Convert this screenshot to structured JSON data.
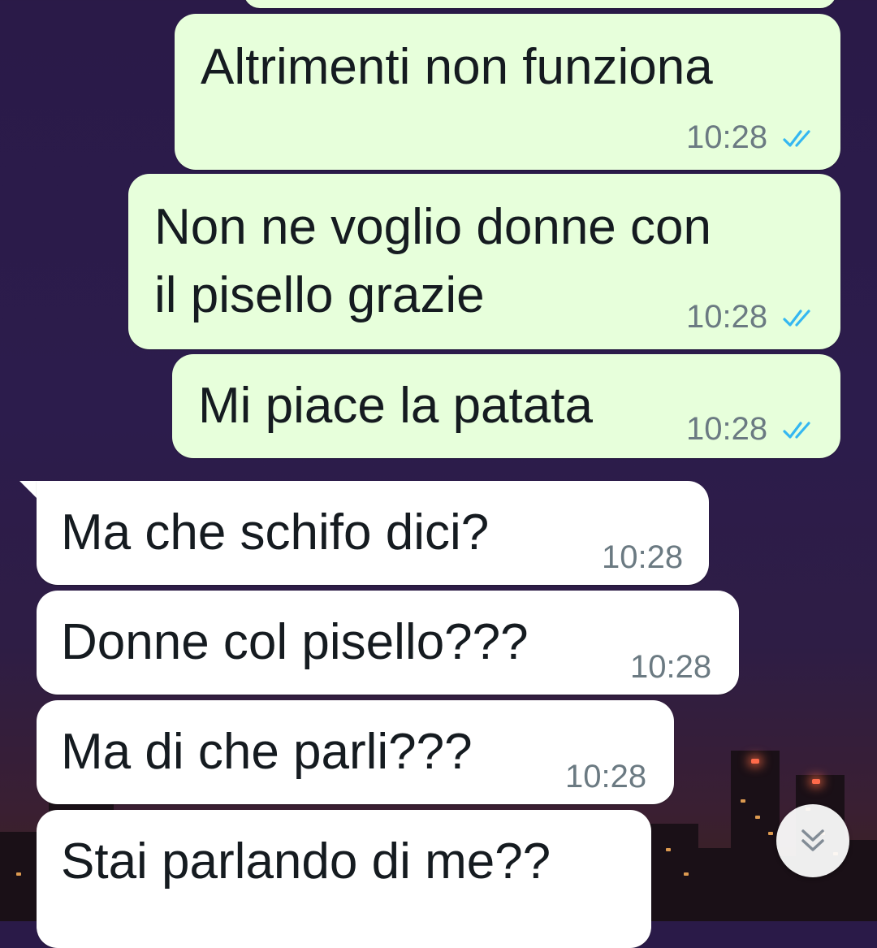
{
  "messages": [
    {
      "direction": "out",
      "text": "Altrimenti non funziona",
      "time": "10:28",
      "status": "read"
    },
    {
      "direction": "out",
      "text_line1": "Non ne voglio donne con",
      "text_line2": "il pisello grazie",
      "time": "10:28",
      "status": "read"
    },
    {
      "direction": "out",
      "text": "Mi piace la patata",
      "time": "10:28",
      "status": "read"
    },
    {
      "direction": "in",
      "text": "Ma che schifo dici?",
      "time": "10:28"
    },
    {
      "direction": "in",
      "text": "Donne col pisello???",
      "time": "10:28"
    },
    {
      "direction": "in",
      "text": "Ma di che parli???",
      "time": "10:28"
    },
    {
      "direction": "in",
      "text": "Stai parlando di me??"
    }
  ],
  "icons": {
    "read_receipt": "double-check-icon",
    "scroll_down": "chevron-double-down-icon"
  },
  "colors": {
    "outgoing_bubble": "#e7ffdb",
    "incoming_bubble": "#ffffff",
    "read_tick": "#34b7f1",
    "timestamp": "#6b7a82"
  }
}
